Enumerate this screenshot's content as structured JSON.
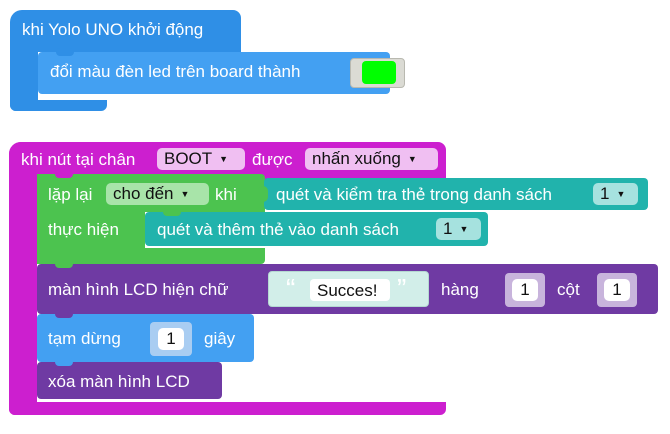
{
  "start_block": {
    "hat_label": "khi Yolo UNO khởi động",
    "led_label": "đổi màu đèn led trên board thành",
    "led_color": "#00ff00"
  },
  "button_block": {
    "prefix": "khi nút tại chân",
    "pin_value": "BOOT",
    "event_prefix": "được",
    "event_value": "nhấn xuống",
    "repeat_label": "lặp lại",
    "repeat_mode": "cho đến",
    "when_label": "khi",
    "scan_label": "quét và kiểm tra thẻ trong danh sách",
    "scan_list": "1",
    "do_label": "thực hiện",
    "add_label": "quét và thêm thẻ vào danh sách",
    "add_list": "1",
    "lcd_label": "màn hình LCD hiện chữ",
    "lcd_text": "Succes!",
    "quote_open": "“",
    "quote_close": "”",
    "row_label": "hàng",
    "row_value": "1",
    "col_label": "cột",
    "col_value": "1",
    "pause_label": "tạm dừng",
    "pause_value": "1",
    "seconds_label": "giây",
    "clear_label": "xóa màn hình LCD"
  },
  "colors": {
    "start_block": "#2f8fe6",
    "button_block": "#cc1fcf",
    "loop_block": "#4cc34f",
    "scan_block": "#21b3ac",
    "lcd_block": "#6f3aa3"
  }
}
